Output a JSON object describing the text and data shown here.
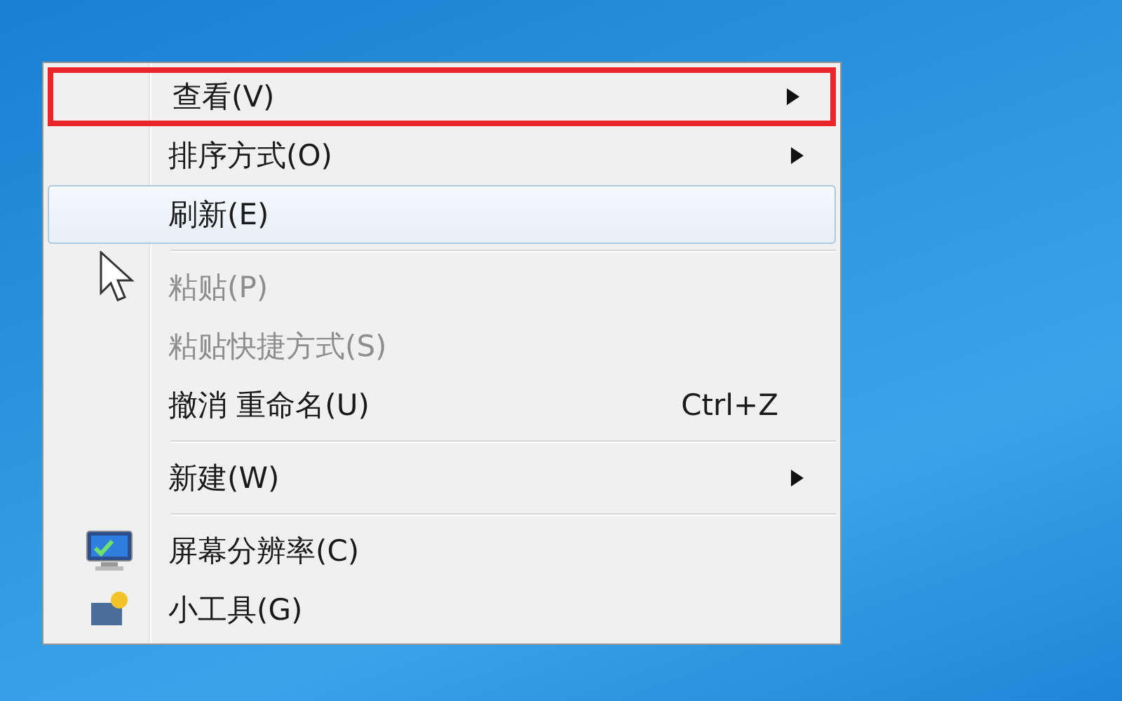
{
  "context_menu": {
    "items": [
      {
        "kind": "item",
        "label": "查看(V)",
        "submenu": true,
        "framed": true,
        "selected": false,
        "disabled": false
      },
      {
        "kind": "item",
        "label": "排序方式(O)",
        "submenu": true,
        "framed": false,
        "selected": false,
        "disabled": false
      },
      {
        "kind": "item",
        "label": "刷新(E)",
        "submenu": false,
        "framed": false,
        "selected": true,
        "disabled": false
      },
      {
        "kind": "separator"
      },
      {
        "kind": "item",
        "label": "粘贴(P)",
        "submenu": false,
        "framed": false,
        "selected": false,
        "disabled": true
      },
      {
        "kind": "item",
        "label": "粘贴快捷方式(S)",
        "submenu": false,
        "framed": false,
        "selected": false,
        "disabled": true
      },
      {
        "kind": "item",
        "label": "撤消 重命名(U)",
        "shortcut": "Ctrl+Z",
        "submenu": false,
        "framed": false,
        "selected": false,
        "disabled": false
      },
      {
        "kind": "separator"
      },
      {
        "kind": "item",
        "label": "新建(W)",
        "submenu": true,
        "framed": false,
        "selected": false,
        "disabled": false
      },
      {
        "kind": "separator"
      },
      {
        "kind": "item",
        "label": "屏幕分辨率(C)",
        "has_icon": true,
        "submenu": false,
        "framed": false,
        "selected": false,
        "disabled": false
      },
      {
        "kind": "item",
        "label": "小工具(G)",
        "has_icon": true,
        "submenu": false,
        "framed": false,
        "selected": false,
        "disabled": false
      }
    ]
  }
}
